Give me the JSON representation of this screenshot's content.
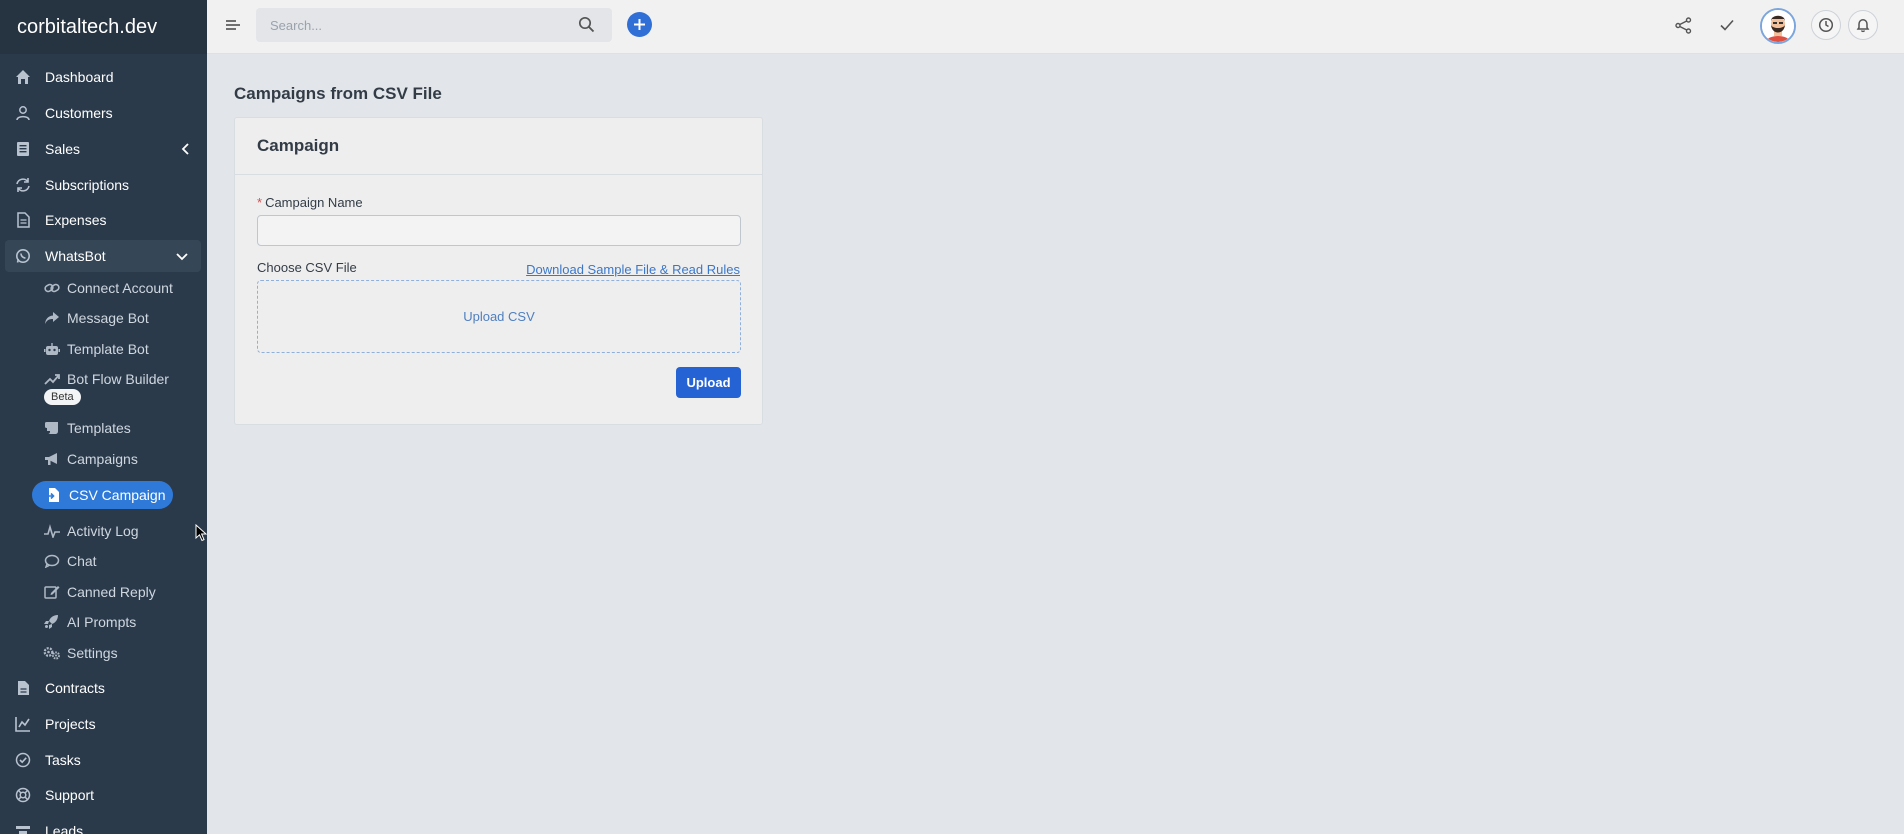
{
  "brand": "corbitaltech.dev",
  "search": {
    "placeholder": "Search..."
  },
  "sidebar": {
    "main_top": [
      {
        "label": "Dashboard",
        "icon": "home-icon"
      },
      {
        "label": "Customers",
        "icon": "user-icon"
      },
      {
        "label": "Sales",
        "icon": "receipt-icon"
      },
      {
        "label": "Subscriptions",
        "icon": "refresh-icon"
      },
      {
        "label": "Expenses",
        "icon": "file-icon"
      },
      {
        "label": "WhatsBot",
        "icon": "whatsapp-icon"
      }
    ],
    "whatsbot_items": [
      {
        "label": "Connect Account",
        "icon": "link-icon"
      },
      {
        "label": "Message Bot",
        "icon": "share-arrow-icon"
      },
      {
        "label": "Template Bot",
        "icon": "robot-icon"
      },
      {
        "label": "Bot Flow Builder",
        "icon": "trend-icon"
      },
      {
        "label": "Templates",
        "icon": "scroll-icon"
      },
      {
        "label": "Campaigns",
        "icon": "megaphone-icon"
      },
      {
        "label": "CSV Campaign",
        "icon": "file-import-icon"
      },
      {
        "label": "Activity Log",
        "icon": "pulse-icon"
      },
      {
        "label": "Chat",
        "icon": "chat-icon"
      },
      {
        "label": "Canned Reply",
        "icon": "edit-icon"
      },
      {
        "label": "AI Prompts",
        "icon": "rocket-icon"
      },
      {
        "label": "Settings",
        "icon": "gears-icon"
      }
    ],
    "beta_badge": "Beta",
    "main_bottom": [
      {
        "label": "Contracts",
        "icon": "contract-icon"
      },
      {
        "label": "Projects",
        "icon": "chart-icon"
      },
      {
        "label": "Tasks",
        "icon": "check-circle-icon"
      },
      {
        "label": "Support",
        "icon": "lifebuoy-icon"
      },
      {
        "label": "Leads",
        "icon": "leads-icon"
      }
    ]
  },
  "page": {
    "title": "Campaigns from CSV File",
    "card_title": "Campaign",
    "required_mark": "*",
    "campaign_name_label": "Campaign Name",
    "campaign_name_value": "",
    "csv_label": "Choose CSV File",
    "sample_link": "Download Sample File & Read Rules",
    "dropzone_text": "Upload CSV",
    "upload_button": "Upload"
  },
  "colors": {
    "sidebar_bg": "#2b3a4a",
    "accent": "#2f7ad8",
    "button": "#2563d4",
    "link": "#3b77c9"
  }
}
